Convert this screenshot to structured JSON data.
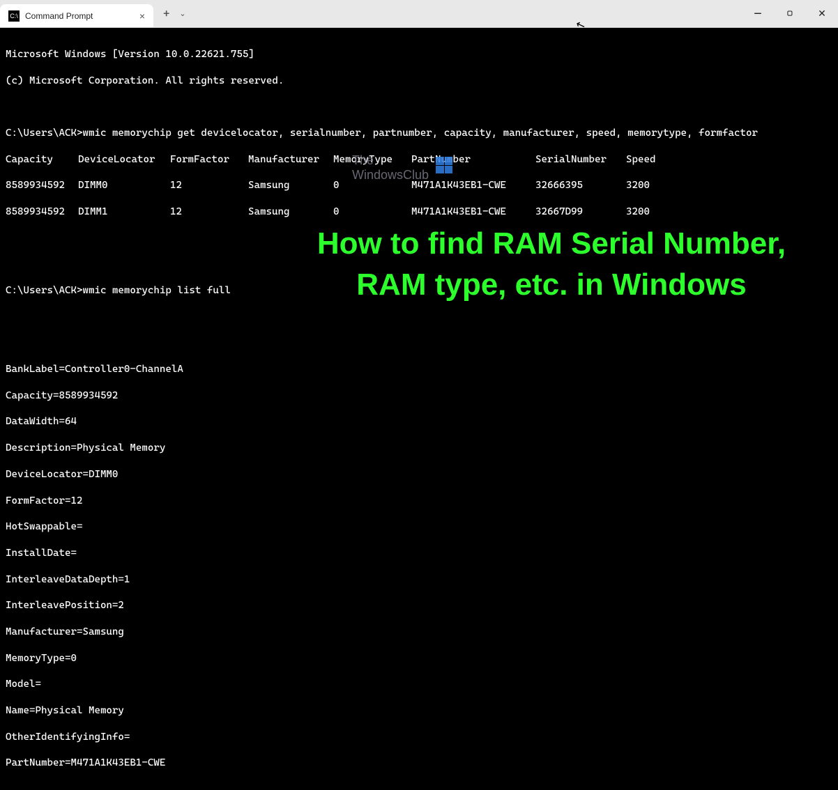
{
  "tab": {
    "title": "Command Prompt"
  },
  "header_line1": "Microsoft Windows [Version 10.0.22621.755]",
  "header_line2": "(c) Microsoft Corporation. All rights reserved.",
  "prompt1": "C:\\Users\\ACK>",
  "cmd1": "wmic memorychip get devicelocator, serialnumber, partnumber, capacity, manufacturer, speed, memorytype, formfactor",
  "table": {
    "headers": [
      "Capacity",
      "DeviceLocator",
      "FormFactor",
      "Manufacturer",
      "MemoryType",
      "PartNumber",
      "SerialNumber",
      "Speed"
    ],
    "rows": [
      [
        "8589934592",
        "DIMM0",
        "12",
        "Samsung",
        "0",
        "M471A1K43EB1-CWE",
        "32666395",
        "3200"
      ],
      [
        "8589934592",
        "DIMM1",
        "12",
        "Samsung",
        "0",
        "M471A1K43EB1-CWE",
        "32667D99",
        "3200"
      ]
    ]
  },
  "prompt2": "C:\\Users\\ACK>",
  "cmd2": "wmic memorychip list full",
  "listfull": [
    "BankLabel=Controller0-ChannelA",
    "Capacity=8589934592",
    "DataWidth=64",
    "Description=Physical Memory",
    "DeviceLocator=DIMM0",
    "FormFactor=12",
    "HotSwappable=",
    "InstallDate=",
    "InterleaveDataDepth=1",
    "InterleavePosition=2",
    "Manufacturer=Samsung",
    "MemoryType=0",
    "Model=",
    "Name=Physical Memory",
    "OtherIdentifyingInfo=",
    "PartNumber=M471A1K43EB1-CWE"
  ],
  "watermark": {
    "text1": "The",
    "text2": "WindowsClub"
  },
  "overlay": "How to find RAM Serial Number, RAM type, etc. in Windows"
}
